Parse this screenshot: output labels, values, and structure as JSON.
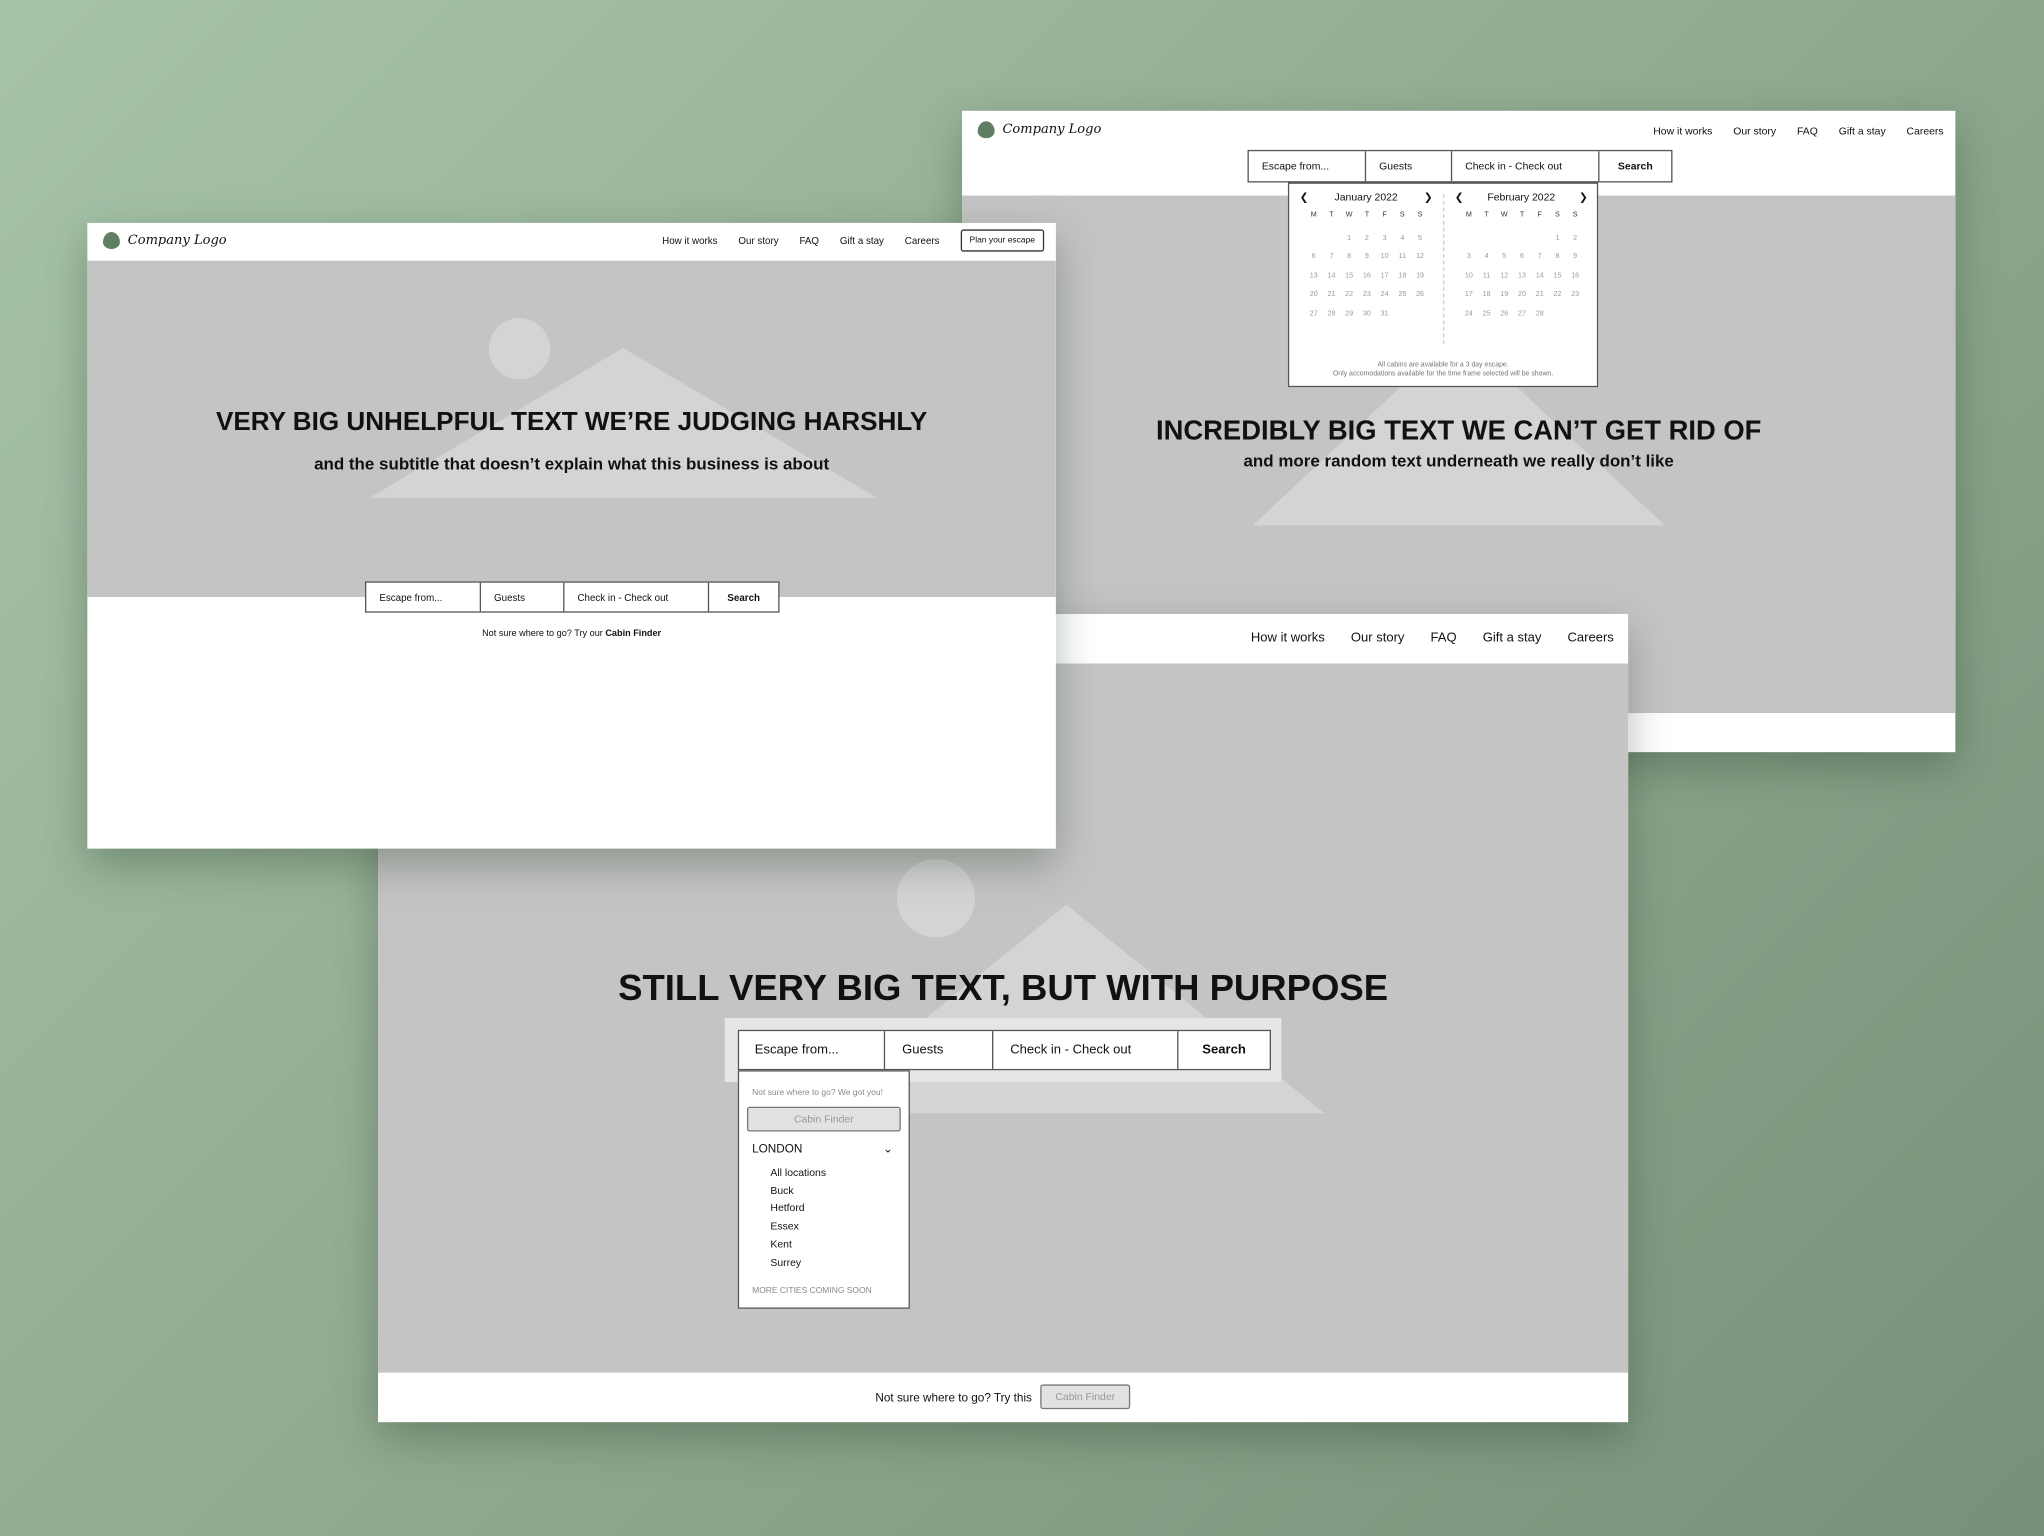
{
  "logo_text": "Company Logo",
  "nav": [
    "How it works",
    "Our story",
    "FAQ",
    "Gift a stay",
    "Careers"
  ],
  "screen_a": {
    "cta": "Plan your escape",
    "headline": "VERY BIG UNHELPFUL TEXT WE’RE JUDGING HARSHLY",
    "subtitle": "and the subtitle that doesn’t explain what this business is about",
    "search": {
      "where": "Escape from...",
      "guests": "Guests",
      "dates": "Check in - Check out",
      "button": "Search"
    },
    "finder_prefix": "Not sure where to go? Try our ",
    "finder_link": "Cabin Finder"
  },
  "screen_b": {
    "headline": "INCREDIBLY BIG TEXT WE CAN’T GET RID OF",
    "subtitle": "and more random text underneath we really don’t like",
    "search": {
      "where": "Escape from...",
      "guests": "Guests",
      "dates": "Check in - Check out",
      "button": "Search"
    },
    "calendar": {
      "weekdays": [
        "M",
        "T",
        "W",
        "T",
        "F",
        "S",
        "S"
      ],
      "months": [
        {
          "name": "January 2022",
          "offset": 2,
          "days": 31
        },
        {
          "name": "February 2022",
          "offset": 5,
          "days": 28
        }
      ],
      "note1": "All cabins are available for a 3 day escape.",
      "note2": "Only accomodations available for the time frame selected will be shown."
    }
  },
  "screen_c": {
    "headline": "STILL VERY BIG TEXT, BUT WITH PURPOSE",
    "search": {
      "where": "Escape from...",
      "guests": "Guests",
      "dates": "Check in - Check out",
      "button": "Search"
    },
    "dropdown": {
      "hint": "Not sure where to go? We got you!",
      "finder_button": "Cabin Finder",
      "city": "LONDON",
      "locations": [
        "All locations",
        "Buck",
        "Hetford",
        "Essex",
        "Kent",
        "Surrey"
      ],
      "footer": "MORE CITIES COMING SOON"
    },
    "footer_text": "Not sure where to go? Try this",
    "footer_button": "Cabin Finder"
  }
}
